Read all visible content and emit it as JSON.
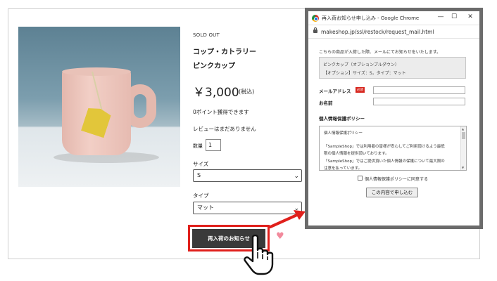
{
  "product": {
    "status": "SOLD OUT",
    "name_line1": "コップ・カトラリー",
    "name_line2": "ピンクカップ",
    "price": "￥3,000",
    "tax_note": "(税込)",
    "points": "0ポイント獲得できます",
    "review": "レビューはまだありません",
    "quantity_label": "数量",
    "quantity_value": "1",
    "size_label": "サイズ",
    "size_value": "S",
    "type_label": "タイプ",
    "type_value": "マット",
    "restock_button": "再入荷のお知らせ"
  },
  "popup": {
    "title": "再入荷お知らせ申し込み - Google Chrome",
    "url": "makeshop.jp/ssl/restock/request_mail.html",
    "intro": "こちらの商品が入荷した際、メールにてお知らせをいたします。",
    "item_line1": "ピンクカップ（オプションプルダウン）",
    "item_line2": "【オプション】サイズ：S，タイプ：マット",
    "email_label": "メールアドレス",
    "required_badge": "必須",
    "name_label": "お名前",
    "policy_heading": "個人情報保護ポリシー",
    "policy_lines": [
      "個人情報保護ポリシー",
      "「SampleShop」では利用者の皆様が安心してご利用頂けるよう最低",
      "限の個人情報を提供頂いております。",
      "「SampleShop」ではご提供頂いた個人情報の保護について最大限の",
      "注意を払っています。"
    ],
    "agree_label": "個人情報保護ポリシーに同意する",
    "submit_label": "この内容で申し込む"
  },
  "colors": {
    "highlight_red": "#e0201c",
    "button_dark": "#3a3a3a",
    "heart_pink": "#f28a9c",
    "required_red": "#d7261e"
  }
}
